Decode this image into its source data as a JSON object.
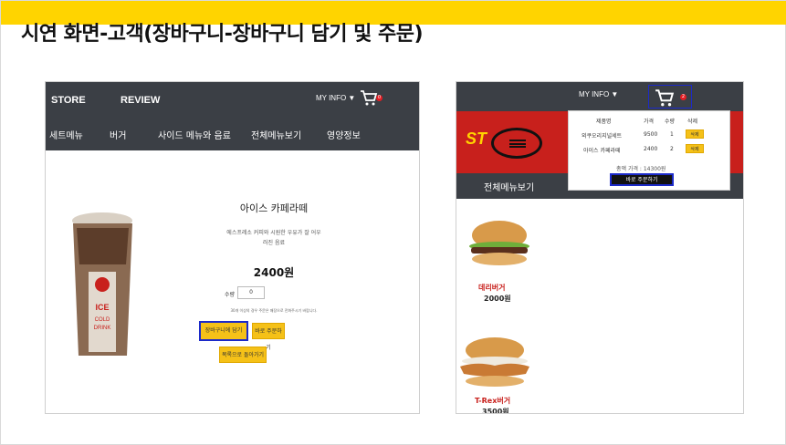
{
  "slide": {
    "title": "시연 화면-고객(장바구니-장바구니 담기 및 주문)"
  },
  "left_screen": {
    "nav": {
      "store": "STORE",
      "review": "REVIEW",
      "myinfo": "MY INFO ▼",
      "cart_count": "0"
    },
    "categories": [
      "세트메뉴",
      "버거",
      "사이드 메뉴와 음료",
      "전체메뉴보기",
      "영양정보"
    ],
    "product": {
      "name": "아이스 카페라떼",
      "description_line1": "에스프레소 커피와 시원한 우유가 잘 어우",
      "description_line2": "러진 음료",
      "price": "2400원",
      "qty_label": "수량",
      "qty_value": "0",
      "note": "30개 이상의 경우 주문은 매장으로 전화주시기 바랍니다.",
      "add_cart_label": "장바구니에 담기",
      "order_now_label": "바로 주문하기",
      "back_label": "목록으로 돌아가기"
    }
  },
  "right_screen": {
    "myinfo": "MY INFO ▼",
    "cart_count": "2",
    "banner_text": "ST",
    "nav_label": "전체메뉴보기",
    "cart_dropdown": {
      "headers": [
        "제품명",
        "가격",
        "수량",
        "삭제"
      ],
      "rows": [
        {
          "name": "외쿠오리지널세트",
          "price": "9500",
          "qty": "1",
          "delete": "삭제"
        },
        {
          "name": "아이스 카페라떼",
          "price": "2400",
          "qty": "2",
          "delete": "삭제"
        }
      ],
      "total": "총액 가격 : 14300원",
      "order_label": "바로 주문하기"
    },
    "items": [
      {
        "name": "데리버거",
        "price": "2000원"
      },
      {
        "name": "T-Rex버거",
        "price": "3500원"
      }
    ]
  },
  "colors": {
    "accent_yellow": "#ffd400",
    "dark_nav": "#3b3f45",
    "brand_red": "#c8201c",
    "highlight_blue": "#1c2ac9"
  }
}
